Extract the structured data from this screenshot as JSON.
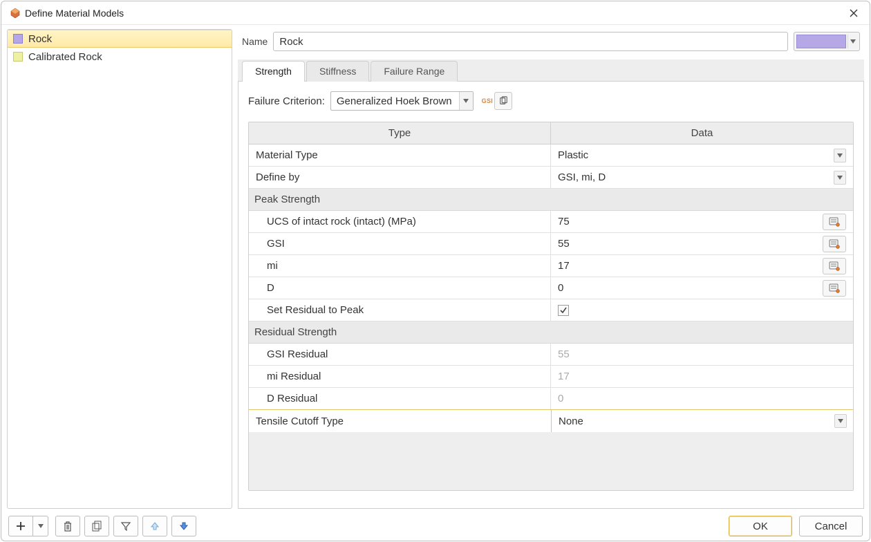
{
  "window": {
    "title": "Define Material Models"
  },
  "materials": [
    {
      "name": "Rock",
      "swatch": "purple",
      "selected": true
    },
    {
      "name": "Calibrated Rock",
      "swatch": "yellow",
      "selected": false
    }
  ],
  "name_field": {
    "label": "Name",
    "value": "Rock"
  },
  "color_swatch": "#b6a8e6",
  "tabs": [
    {
      "label": "Strength",
      "active": true
    },
    {
      "label": "Stiffness",
      "active": false
    },
    {
      "label": "Failure Range",
      "active": false
    }
  ],
  "failure_criterion": {
    "label": "Failure Criterion:",
    "value": "Generalized Hoek Brown"
  },
  "table": {
    "headers": {
      "type": "Type",
      "data": "Data"
    },
    "rows": {
      "material_type": {
        "label": "Material Type",
        "value": "Plastic",
        "is_dropdown": true
      },
      "define_by": {
        "label": "Define by",
        "value": "GSI, mi, D",
        "is_dropdown": true
      }
    },
    "peak_header": "Peak Strength",
    "peak": {
      "ucs": {
        "label": "UCS of intact rock (intact) (MPa)",
        "value": "75"
      },
      "gsi": {
        "label": "GSI",
        "value": "55"
      },
      "mi": {
        "label": "mi",
        "value": "17"
      },
      "d": {
        "label": "D",
        "value": "0"
      },
      "set_residual": {
        "label": "Set Residual to Peak",
        "checked": true
      }
    },
    "residual_header": "Residual Strength",
    "residual": {
      "gsi": {
        "label": "GSI Residual",
        "value": "55"
      },
      "mi": {
        "label": "mi Residual",
        "value": "17"
      },
      "d": {
        "label": "D Residual",
        "value": "0"
      }
    },
    "tensile_cutoff": {
      "label": "Tensile Cutoff Type",
      "value": "None",
      "is_dropdown": true
    }
  },
  "buttons": {
    "ok": "OK",
    "cancel": "Cancel"
  }
}
